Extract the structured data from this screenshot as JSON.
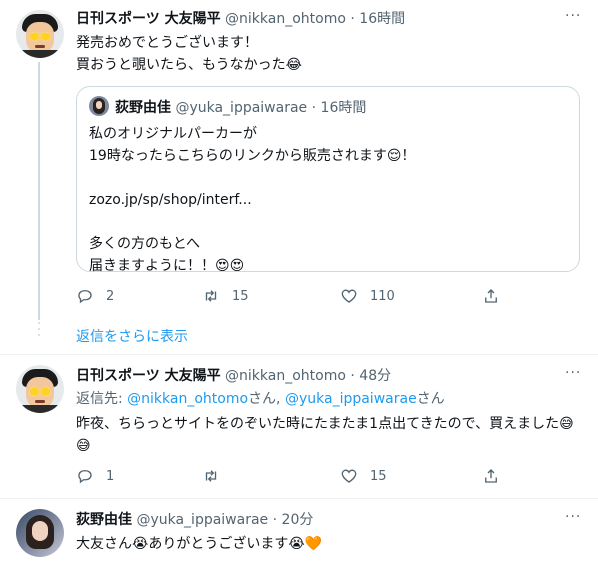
{
  "tweets": [
    {
      "name": "日刊スポーツ 大友陽平",
      "handle": "@nikkan_ohtomo",
      "time": "16時間",
      "text": "発売おめでとうございます！\n買おうと覗いたら、もうなかった😂",
      "quote": {
        "name": "荻野由佳",
        "handle": "@yuka_ippaiwarae",
        "time": "16時間",
        "line1": "私のオリジナルパーカーが",
        "line2": "19時なったらこちらのリンクから販売されます😌！",
        "link": "zozo.jp/sp/shop/interf...",
        "line3": "多くの方のもとへ",
        "line4": "届きますように！！😍😍"
      },
      "replies": "2",
      "retweets": "15",
      "likes": "110"
    },
    {
      "name": "日刊スポーツ 大友陽平",
      "handle": "@nikkan_ohtomo",
      "time": "48分",
      "reply_prefix": "返信先: ",
      "reply_to_1": "@nikkan_ohtomo",
      "reply_sep": "さん, ",
      "reply_to_2": "@yuka_ippaiwarae",
      "reply_suffix": "さん",
      "text": "昨夜、ちらっとサイトをのぞいた時にたまたま1点出てきたので、買えました😅😅",
      "replies": "1",
      "retweets": "",
      "likes": "15"
    },
    {
      "name": "荻野由佳",
      "handle": "@yuka_ippaiwarae",
      "time": "20分",
      "text": "大友さん😭ありがとうございます😭🧡"
    }
  ],
  "show_more": "返信をさらに表示",
  "separator": " · ",
  "more_icon": "···"
}
